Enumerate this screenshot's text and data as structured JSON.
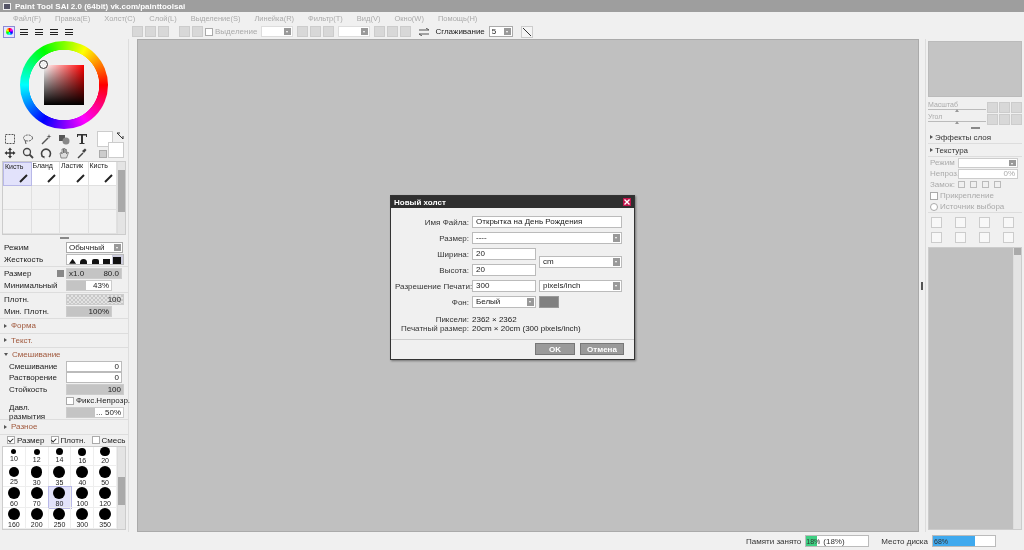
{
  "window": {
    "title": "Paint Tool SAI 2.0 (64bit) vk.com/painttoolsai"
  },
  "menu": [
    {
      "label": "Файл(F)"
    },
    {
      "label": "Правка(E)"
    },
    {
      "label": "Холст(C)"
    },
    {
      "label": "Слой(L)"
    },
    {
      "label": "Выделение(S)"
    },
    {
      "label": "Линейка(R)"
    },
    {
      "label": "Фильтр(T)"
    },
    {
      "label": "Вид(V)"
    },
    {
      "label": "Окно(W)"
    },
    {
      "label": "Помощь(H)"
    }
  ],
  "view_tabs": [
    {
      "selected": true
    },
    {
      "selected": false
    },
    {
      "selected": false
    },
    {
      "selected": false
    },
    {
      "selected": false
    }
  ],
  "toolbar": {
    "selection": {
      "label": "Выделение",
      "checked": false
    },
    "smoothing": {
      "label": "Сглаживание",
      "value": "5"
    }
  },
  "brushes": [
    {
      "label": "Кисть",
      "selected": true
    },
    {
      "label": "Бланд",
      "selected": false
    },
    {
      "label": "Ластик",
      "selected": false
    },
    {
      "label": "Кисть",
      "selected": false
    }
  ],
  "brush_settings": [
    [
      {
        "kind": "select",
        "label": "Режим",
        "value": "Обычный"
      },
      {
        "kind": "hardness",
        "label": "Жесткость",
        "levels": [
          {
            "selected": false
          },
          {
            "selected": false
          },
          {
            "selected": false
          },
          {
            "selected": false
          },
          {
            "selected": true
          }
        ]
      }
    ],
    [
      {
        "kind": "size",
        "label": "Размер",
        "multiplier": "x1.0",
        "value": "80.0",
        "level": 1
      },
      {
        "kind": "slider",
        "label": "Минимальный",
        "value": "43%",
        "level": 0.43
      }
    ],
    [
      {
        "kind": "slider",
        "label": "Плотн.",
        "value": "100",
        "level": 1
      },
      {
        "kind": "slider",
        "label": "Мин. Плотн.",
        "value": "100%",
        "level": 1
      }
    ],
    [
      {
        "kind": "section",
        "label": "Форма",
        "expanded": false
      }
    ],
    [
      {
        "kind": "section",
        "label": "Текст.",
        "expanded": false
      }
    ],
    [
      {
        "kind": "section",
        "label": "Смешивание",
        "expanded": true
      },
      {
        "kind": "number",
        "label": "Смешивание",
        "value": "0"
      },
      {
        "kind": "number",
        "label": "Растворение",
        "value": "0"
      },
      {
        "kind": "slider",
        "label": "Стойкость",
        "value": "100",
        "level": 1
      },
      {
        "kind": "checkbox",
        "label": "Фикс.Непрозр.",
        "checked": false
      },
      {
        "kind": "slider",
        "label": "Давл. размытия",
        "value": "... 50%",
        "level": 0.5
      }
    ],
    [
      {
        "kind": "section",
        "label": "Разное",
        "expanded": false
      }
    ]
  ],
  "brush_options": [
    {
      "label": "Размер",
      "checked": true
    },
    {
      "label": "Плотн.",
      "checked": true
    },
    {
      "label": "Смесь",
      "checked": false
    }
  ],
  "brush_sizes": [
    {
      "label": "10",
      "selected": false
    },
    {
      "label": "12",
      "selected": false
    },
    {
      "label": "14",
      "selected": false
    },
    {
      "label": "16",
      "selected": false
    },
    {
      "label": "20",
      "selected": false
    },
    {
      "label": "25",
      "selected": false
    },
    {
      "label": "30",
      "selected": false
    },
    {
      "label": "35",
      "selected": false
    },
    {
      "label": "40",
      "selected": false
    },
    {
      "label": "50",
      "selected": false
    },
    {
      "label": "60",
      "selected": false
    },
    {
      "label": "70",
      "selected": false
    },
    {
      "label": "80",
      "selected": true
    },
    {
      "label": "100",
      "selected": false
    },
    {
      "label": "120",
      "selected": false
    },
    {
      "label": "160",
      "selected": false
    },
    {
      "label": "200",
      "selected": false
    },
    {
      "label": "250",
      "selected": false
    },
    {
      "label": "300",
      "selected": false
    },
    {
      "label": "350",
      "selected": false
    }
  ],
  "dialog": {
    "title": "Новый холст",
    "file_name": {
      "label": "Имя Файла:",
      "value": "Открытка на День Рождения"
    },
    "size": {
      "label": "Размер:",
      "value": "----"
    },
    "width": {
      "label": "Ширина:",
      "value": "20"
    },
    "height": {
      "label": "Высота:",
      "value": "20"
    },
    "unit": "cm",
    "resolution": {
      "label": "Разрешение Печати:",
      "value": "300",
      "unit": "pixels/inch"
    },
    "background": {
      "label": "Фон:",
      "value": "Белый",
      "color": "#808080"
    },
    "pixels": {
      "label": "Пиксели:",
      "value": "2362 × 2362"
    },
    "print_size": {
      "label": "Печатный размер:",
      "value": "20cm × 20cm (300 pixels/inch)"
    },
    "buttons": [
      "OK",
      "Отмена"
    ]
  },
  "navigator": {
    "zoom": {
      "label": "Масштаб",
      "level": 0.5
    },
    "angle": {
      "label": "Угол",
      "level": 0.5
    }
  },
  "layer_panel": {
    "sections": [
      {
        "label": "Эффекты слоя",
        "expanded": false
      },
      {
        "label": "Текстура",
        "expanded": false
      }
    ],
    "mode_label": "Режим",
    "opacity": {
      "label": "Непроз.",
      "value": "0%"
    },
    "lock_label": "Замок:",
    "clipping": {
      "label": "Прикрепление",
      "checked": false
    },
    "selection_source": {
      "label": "Источник выбора",
      "selected": false
    }
  },
  "status": {
    "memory": {
      "label": "Памяти занято",
      "value": "18%",
      "detail": "(18%)",
      "level": 0.18
    },
    "disk": {
      "label": "Место диска",
      "value": "68%",
      "level": 0.68
    }
  }
}
